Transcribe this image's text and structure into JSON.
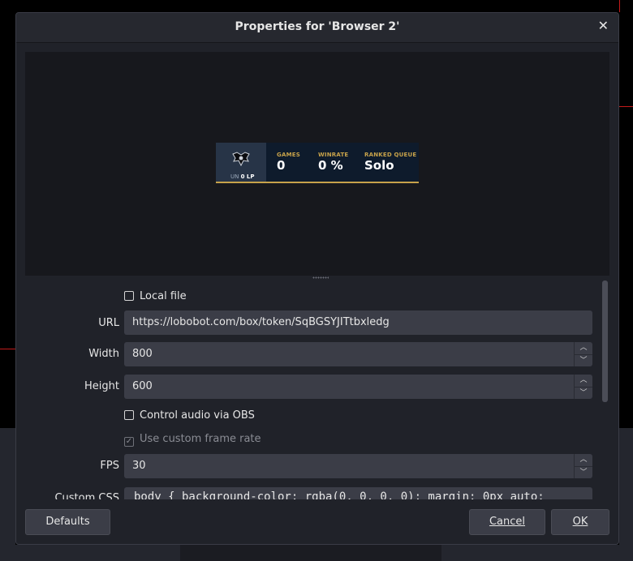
{
  "dialog": {
    "title": "Properties for 'Browser 2'",
    "close_glyph": "✕"
  },
  "overlay": {
    "rank_prefix": "UN",
    "rank_lp": "0 LP",
    "stats": [
      {
        "label": "GAMES",
        "value": "0"
      },
      {
        "label": "WINRATE",
        "value": "0 %"
      },
      {
        "label": "RANKED QUEUE",
        "value": "Solo"
      }
    ],
    "accent": "#c7a24a"
  },
  "properties": {
    "local_file": {
      "label": "Local file",
      "checked": false
    },
    "url": {
      "label": "URL",
      "value": "https://lobobot.com/box/token/SqBGSYJITtbxledg"
    },
    "width": {
      "label": "Width",
      "value": "800"
    },
    "height": {
      "label": "Height",
      "value": "600"
    },
    "control_audio": {
      "label": "Control audio via OBS",
      "checked": false
    },
    "custom_frame_rate": {
      "label": "Use custom frame rate",
      "checked": true,
      "disabled": true
    },
    "fps": {
      "label": "FPS",
      "value": "30"
    },
    "custom_css": {
      "label": "Custom CSS",
      "value": "body { background-color: rgba(0, 0, 0, 0); margin: 0px auto;"
    }
  },
  "buttons": {
    "defaults": "Defaults",
    "cancel": "Cancel",
    "ok": "OK"
  }
}
